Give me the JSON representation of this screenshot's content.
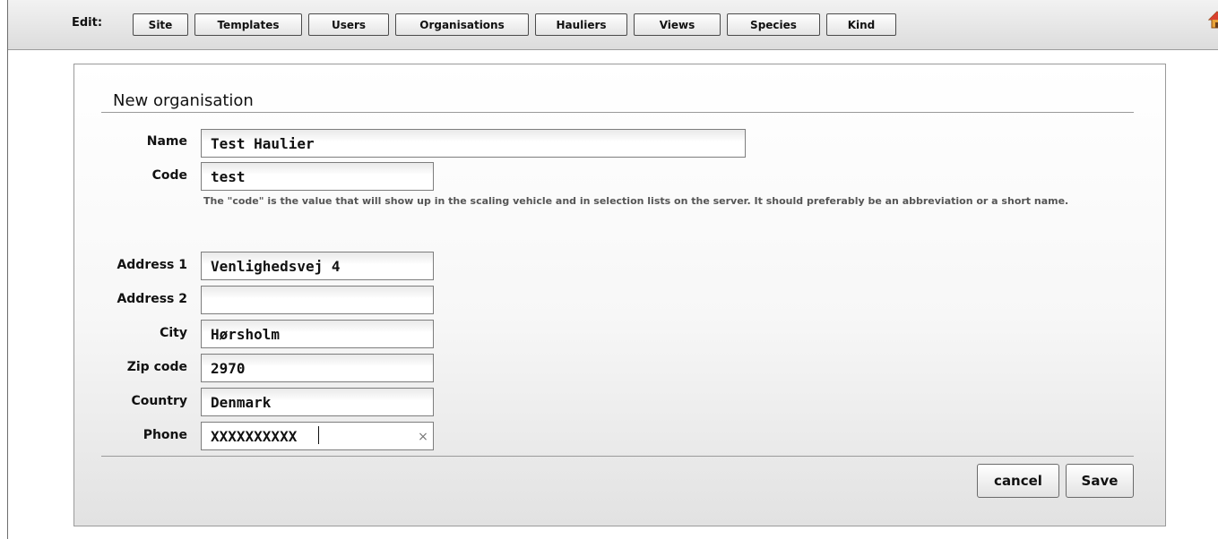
{
  "toolbar": {
    "edit_label": "Edit:",
    "buttons": [
      {
        "label": "Site"
      },
      {
        "label": "Templates"
      },
      {
        "label": "Users"
      },
      {
        "label": "Organisations"
      },
      {
        "label": "Hauliers"
      },
      {
        "label": "Views"
      },
      {
        "label": "Species"
      },
      {
        "label": "Kind"
      }
    ],
    "home_icon": "home-icon"
  },
  "form": {
    "title": "New organisation",
    "fields": {
      "name": {
        "label": "Name",
        "value": "Test Haulier"
      },
      "code": {
        "label": "Code",
        "value": "test"
      },
      "address1": {
        "label": "Address 1",
        "value": "Venlighedsvej 4"
      },
      "address2": {
        "label": "Address 2",
        "value": ""
      },
      "city": {
        "label": "City",
        "value": "Hørsholm"
      },
      "zip": {
        "label": "Zip code",
        "value": "2970"
      },
      "country": {
        "label": "Country",
        "value": "Denmark"
      },
      "phone": {
        "label": "Phone",
        "value": "XXXXXXXXXX"
      }
    },
    "code_help": "The \"code\" is the value that will show up in the scaling vehicle and in selection lists on the server. It should preferably be an abbreviation or a short name.",
    "clear_symbol": "×",
    "cancel_label": "cancel",
    "save_label": "Save"
  },
  "colors": {
    "toolbar_bg": "#e6e6e6",
    "border": "#4a4a4a",
    "help_text": "#555555"
  }
}
